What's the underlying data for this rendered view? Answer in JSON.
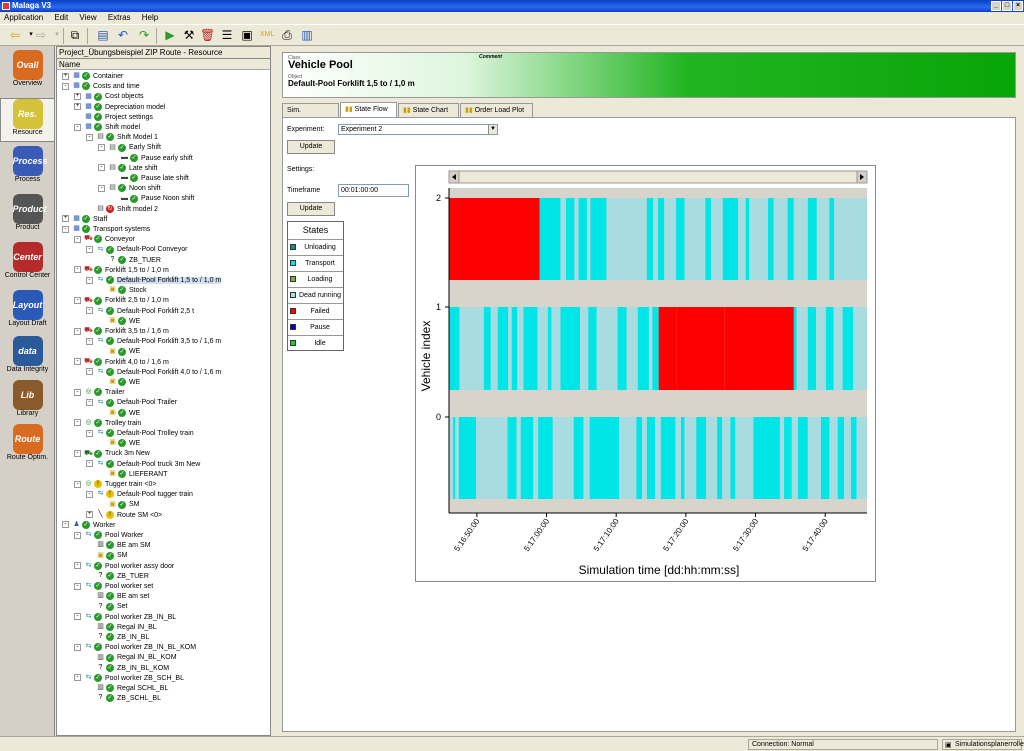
{
  "window": {
    "title": "Malaga V3"
  },
  "menu": [
    "Application",
    "Edit",
    "View",
    "Extras",
    "Help"
  ],
  "leftbar": [
    {
      "label": "Overview",
      "icon": "overview-icon",
      "color": "#d86b20",
      "text": "Ovall"
    },
    {
      "label": "Resource",
      "icon": "resource-icon",
      "color": "#d4c33a",
      "text": "Res.",
      "active": true
    },
    {
      "label": "Process",
      "icon": "process-icon",
      "color": "#3a5ab8",
      "text": "Process"
    },
    {
      "label": "Product",
      "icon": "product-icon",
      "color": "#555",
      "text": "Product"
    },
    {
      "label": "Control Center",
      "icon": "control-center-icon",
      "color": "#b52a2a",
      "text": "Center"
    },
    {
      "label": "Layout Draft",
      "icon": "layout-draft-icon",
      "color": "#2a5ab8",
      "text": "Layout"
    },
    {
      "label": "Data Integrity",
      "icon": "data-integrity-icon",
      "color": "#2a5a9a",
      "text": "data"
    },
    {
      "label": "Library",
      "icon": "library-icon",
      "color": "#8a5a2a",
      "text": "Lib"
    },
    {
      "label": "Route Optim.",
      "icon": "route-optim-icon",
      "color": "#d86b20",
      "text": "Route"
    }
  ],
  "tree": {
    "title": "Project_Übungsbeispiel ZIP Route - Resource",
    "column": "Name",
    "rows": [
      {
        "t": "Container",
        "l": 0,
        "ex": "+",
        "i": "tb",
        "c": "check"
      },
      {
        "t": "Costs and time",
        "l": 0,
        "ex": "-",
        "i": "tb",
        "c": "check"
      },
      {
        "t": "Cost objects",
        "l": 1,
        "ex": "+",
        "i": "tb",
        "c": "check"
      },
      {
        "t": "Depreciation model",
        "l": 1,
        "ex": "+",
        "i": "tb",
        "c": "check"
      },
      {
        "t": "Project settings",
        "l": 1,
        "ex": "",
        "i": "tb",
        "c": "check"
      },
      {
        "t": "Shift model",
        "l": 1,
        "ex": "-",
        "i": "tb",
        "c": "check"
      },
      {
        "t": "Shift Model 1",
        "l": 2,
        "ex": "-",
        "i": "cal",
        "c": "check"
      },
      {
        "t": "Early Shift",
        "l": 3,
        "ex": "-",
        "i": "cal",
        "c": "check"
      },
      {
        "t": "Pause early shift",
        "l": 4,
        "ex": "",
        "i": "bed",
        "c": "check"
      },
      {
        "t": "Late shift",
        "l": 3,
        "ex": "-",
        "i": "cal",
        "c": "check"
      },
      {
        "t": "Pause late shift",
        "l": 4,
        "ex": "",
        "i": "bed",
        "c": "check"
      },
      {
        "t": "Noon shift",
        "l": 3,
        "ex": "-",
        "i": "cal",
        "c": "check"
      },
      {
        "t": "Pause Noon shift",
        "l": 4,
        "ex": "",
        "i": "bed",
        "c": "check"
      },
      {
        "t": "Shift model 2",
        "l": 2,
        "ex": "",
        "i": "cal",
        "c": "red"
      },
      {
        "t": "Staff",
        "l": 0,
        "ex": "+",
        "i": "tb",
        "c": "check"
      },
      {
        "t": "Transport systems",
        "l": 0,
        "ex": "-",
        "i": "tb",
        "c": "check"
      },
      {
        "t": "Conveyor",
        "l": 1,
        "ex": "-",
        "i": "fork",
        "c": "check"
      },
      {
        "t": "Default-Pool Conveyor",
        "l": 2,
        "ex": "-",
        "i": "pool",
        "c": "check"
      },
      {
        "t": "ZB_TUER",
        "l": 3,
        "ex": "",
        "i": "q",
        "c": "check"
      },
      {
        "t": "Forklift 1,5 to / 1,0 m",
        "l": 1,
        "ex": "-",
        "i": "fork",
        "c": "check"
      },
      {
        "t": "Default-Pool Forklift 1,5 to / 1,0 m",
        "l": 2,
        "ex": "-",
        "i": "pool",
        "c": "check",
        "sel": true
      },
      {
        "t": "Stock",
        "l": 3,
        "ex": "",
        "i": "box",
        "c": "check"
      },
      {
        "t": "Forklift 2,5 to / 1,0 m",
        "l": 1,
        "ex": "-",
        "i": "fork",
        "c": "check"
      },
      {
        "t": "Default-Pool Forklift 2,5 t",
        "l": 2,
        "ex": "-",
        "i": "pool",
        "c": "check"
      },
      {
        "t": "WE",
        "l": 3,
        "ex": "",
        "i": "box",
        "c": "check"
      },
      {
        "t": "Forklift 3,5 to / 1,6 m",
        "l": 1,
        "ex": "-",
        "i": "fork",
        "c": "check"
      },
      {
        "t": "Default-Pool Forklift 3,5 to / 1,6 m",
        "l": 2,
        "ex": "-",
        "i": "pool",
        "c": "check"
      },
      {
        "t": "WE",
        "l": 3,
        "ex": "",
        "i": "box",
        "c": "check"
      },
      {
        "t": "Forklift 4,0 to / 1,6 m",
        "l": 1,
        "ex": "-",
        "i": "fork",
        "c": "check"
      },
      {
        "t": "Default-Pool Forklift 4,0 to / 1,6 m",
        "l": 2,
        "ex": "-",
        "i": "pool",
        "c": "check"
      },
      {
        "t": "WE",
        "l": 3,
        "ex": "",
        "i": "box",
        "c": "check"
      },
      {
        "t": "Trailer",
        "l": 1,
        "ex": "-",
        "i": "ring",
        "c": "check"
      },
      {
        "t": "Default-Pool Trailer",
        "l": 2,
        "ex": "-",
        "i": "pool",
        "c": "check"
      },
      {
        "t": "WE",
        "l": 3,
        "ex": "",
        "i": "box",
        "c": "check"
      },
      {
        "t": "Trolley train",
        "l": 1,
        "ex": "-",
        "i": "ring",
        "c": "check"
      },
      {
        "t": "Default-Pool Trolley train",
        "l": 2,
        "ex": "-",
        "i": "pool",
        "c": "check"
      },
      {
        "t": "WE",
        "l": 3,
        "ex": "",
        "i": "box",
        "c": "check"
      },
      {
        "t": "Truck 3m New",
        "l": 1,
        "ex": "-",
        "i": "truck",
        "c": "check"
      },
      {
        "t": "Default-Pool truck 3m New",
        "l": 2,
        "ex": "-",
        "i": "pool",
        "c": "check"
      },
      {
        "t": "LIEFERANT",
        "l": 3,
        "ex": "",
        "i": "box",
        "c": "check"
      },
      {
        "t": "Tugger train <0>",
        "l": 1,
        "ex": "-",
        "i": "ring",
        "c": "warn"
      },
      {
        "t": "Default-Pool tugger train",
        "l": 2,
        "ex": "-",
        "i": "pool",
        "c": "warn"
      },
      {
        "t": "SM",
        "l": 3,
        "ex": "",
        "i": "box",
        "c": "check"
      },
      {
        "t": "Route SM <0>",
        "l": 2,
        "ex": "+",
        "i": "route",
        "c": "warn"
      },
      {
        "t": "Worker",
        "l": 0,
        "ex": "-",
        "i": "person",
        "c": "check"
      },
      {
        "t": "Pool Worker",
        "l": 1,
        "ex": "-",
        "i": "pool",
        "c": "check"
      },
      {
        "t": "BE am SM",
        "l": 2,
        "ex": "",
        "i": "rack",
        "c": "check"
      },
      {
        "t": "SM",
        "l": 2,
        "ex": "",
        "i": "box",
        "c": "check"
      },
      {
        "t": "Pool worker assy door",
        "l": 1,
        "ex": "-",
        "i": "pool",
        "c": "check"
      },
      {
        "t": "ZB_TUER",
        "l": 2,
        "ex": "",
        "i": "q",
        "c": "check"
      },
      {
        "t": "Pool worker set",
        "l": 1,
        "ex": "-",
        "i": "pool",
        "c": "check"
      },
      {
        "t": "BE am set",
        "l": 2,
        "ex": "",
        "i": "rack",
        "c": "check"
      },
      {
        "t": "Set",
        "l": 2,
        "ex": "",
        "i": "q",
        "c": "check"
      },
      {
        "t": "Pool worker ZB_IN_BL",
        "l": 1,
        "ex": "-",
        "i": "pool",
        "c": "check"
      },
      {
        "t": "Regal IN_BL",
        "l": 2,
        "ex": "",
        "i": "rack",
        "c": "check"
      },
      {
        "t": "ZB_IN_BL",
        "l": 2,
        "ex": "",
        "i": "q",
        "c": "check"
      },
      {
        "t": "Pool worker ZB_IN_BL_KOM",
        "l": 1,
        "ex": "-",
        "i": "pool",
        "c": "check"
      },
      {
        "t": "Regal IN_BL_KOM",
        "l": 2,
        "ex": "",
        "i": "rack",
        "c": "check"
      },
      {
        "t": "ZB_IN_BL_KOM",
        "l": 2,
        "ex": "",
        "i": "q",
        "c": "check"
      },
      {
        "t": "Pool worker ZB_SCH_BL",
        "l": 1,
        "ex": "-",
        "i": "pool",
        "c": "check"
      },
      {
        "t": "Regal SCHL_BL",
        "l": 2,
        "ex": "",
        "i": "rack",
        "c": "check"
      },
      {
        "t": "ZB_SCHL_BL",
        "l": 2,
        "ex": "",
        "i": "q",
        "c": "check"
      }
    ]
  },
  "header": {
    "class_label": "Class",
    "comment_label": "Comment",
    "title": "Vehicle Pool",
    "object_label": "Object",
    "object": "Default-Pool Forklift 1,5 to / 1,0 m"
  },
  "tabs": [
    "Sim. properties",
    "State Flow",
    "State Chart",
    "Order Load Plot"
  ],
  "form": {
    "experiment_label": "Experiment:",
    "experiment_value": "Experiment 2",
    "update1": "Update",
    "settings_label": "Settings:",
    "timeframe_label": "Timeframe",
    "timeframe_value": "00:01:00:00",
    "update2": "Update"
  },
  "states": {
    "title": "States",
    "items": [
      {
        "name": "Unloading",
        "color": "#1a8a8a"
      },
      {
        "name": "Transport",
        "color": "#00e5e5"
      },
      {
        "name": "Loading",
        "color": "#7fb03a"
      },
      {
        "name": "Dead running",
        "color": "#a8dce0"
      },
      {
        "name": "Failed",
        "color": "#ff0000"
      },
      {
        "name": "Pause",
        "color": "#0000c0"
      },
      {
        "name": "Idle",
        "color": "#22cc22"
      }
    ]
  },
  "chart_data": {
    "type": "gantt",
    "ylabel": "Vehicle index",
    "xlabel": "Simulation time [dd:hh:mm:ss]",
    "yticks": [
      "0",
      "1",
      "2"
    ],
    "xticks": [
      "5:16:50:00",
      "5:17:00:00",
      "5:17:10:00",
      "5:17:20:00",
      "5:17:30:00",
      "5:17:40:00"
    ],
    "x_range_min": [
      1006,
      1066
    ],
    "tick_min": [
      1010,
      1020,
      1030,
      1040,
      1050,
      1060
    ],
    "colors": {
      "T": "#00e5e5",
      "D": "#a8dce0",
      "F": "#ff0000",
      "U": "#1a8a8a"
    },
    "vehicles": [
      {
        "index": 2,
        "segments": [
          [
            1006,
            1019,
            "F"
          ],
          [
            1019,
            1021,
            "T"
          ],
          [
            1021,
            1022,
            "T"
          ],
          [
            1022,
            1022.8,
            "D"
          ],
          [
            1022.8,
            1024,
            "T"
          ],
          [
            1024,
            1024.6,
            "D"
          ],
          [
            1024.6,
            1025.8,
            "T"
          ],
          [
            1025.8,
            1026.3,
            "D"
          ],
          [
            1026.3,
            1028.6,
            "T"
          ],
          [
            1028.6,
            1034.4,
            "D"
          ],
          [
            1034.4,
            1035.3,
            "T"
          ],
          [
            1035.3,
            1036,
            "D"
          ],
          [
            1036,
            1036.9,
            "T"
          ],
          [
            1036.9,
            1038.6,
            "D"
          ],
          [
            1038.6,
            1039.8,
            "T"
          ],
          [
            1039.8,
            1042.8,
            "D"
          ],
          [
            1042.8,
            1043.6,
            "T"
          ],
          [
            1043.6,
            1045.3,
            "D"
          ],
          [
            1045.3,
            1047.5,
            "T"
          ],
          [
            1047.5,
            1048.6,
            "D"
          ],
          [
            1048.6,
            1049.1,
            "T"
          ],
          [
            1049.1,
            1051.8,
            "D"
          ],
          [
            1051.8,
            1052.6,
            "T"
          ],
          [
            1052.6,
            1054.6,
            "D"
          ],
          [
            1054.6,
            1055.5,
            "T"
          ],
          [
            1055.5,
            1057.5,
            "D"
          ],
          [
            1057.5,
            1058.8,
            "T"
          ],
          [
            1058.8,
            1060.6,
            "D"
          ],
          [
            1060.6,
            1061.3,
            "T"
          ],
          [
            1061.3,
            1066,
            "D"
          ]
        ]
      },
      {
        "index": 1,
        "segments": [
          [
            1006,
            1007.5,
            "T"
          ],
          [
            1007.5,
            1011,
            "D"
          ],
          [
            1011,
            1012,
            "T"
          ],
          [
            1012,
            1013,
            "D"
          ],
          [
            1013,
            1014.5,
            "T"
          ],
          [
            1014.5,
            1015,
            "D"
          ],
          [
            1015,
            1015.8,
            "T"
          ],
          [
            1015.8,
            1016.7,
            "D"
          ],
          [
            1016.7,
            1018.7,
            "T"
          ],
          [
            1018.7,
            1020.2,
            "D"
          ],
          [
            1020.2,
            1020.7,
            "T"
          ],
          [
            1020.7,
            1022,
            "D"
          ],
          [
            1022,
            1024.8,
            "T"
          ],
          [
            1024.8,
            1026,
            "D"
          ],
          [
            1026,
            1027.2,
            "T"
          ],
          [
            1027.2,
            1030.2,
            "D"
          ],
          [
            1030.2,
            1031.5,
            "T"
          ],
          [
            1031.5,
            1033.1,
            "D"
          ],
          [
            1033.1,
            1034.7,
            "T"
          ],
          [
            1034.7,
            1035.2,
            "D"
          ],
          [
            1035.2,
            1036.1,
            "T"
          ],
          [
            1036.1,
            1038.6,
            "F"
          ],
          [
            1038.6,
            1045.5,
            "F"
          ],
          [
            1045.5,
            1055.5,
            "F"
          ],
          [
            1055.5,
            1055.9,
            "T"
          ],
          [
            1055.9,
            1057.5,
            "D"
          ],
          [
            1057.5,
            1058.7,
            "T"
          ],
          [
            1058.7,
            1060.1,
            "D"
          ],
          [
            1060.1,
            1061.2,
            "T"
          ],
          [
            1061.2,
            1062.5,
            "D"
          ],
          [
            1062.5,
            1064,
            "T"
          ],
          [
            1064,
            1066,
            "D"
          ]
        ]
      },
      {
        "index": 0,
        "segments": [
          [
            1006,
            1006.6,
            "D"
          ],
          [
            1006.6,
            1006.9,
            "T"
          ],
          [
            1006.9,
            1007.4,
            "D"
          ],
          [
            1007.4,
            1009.9,
            "T"
          ],
          [
            1009.9,
            1014.4,
            "D"
          ],
          [
            1014.4,
            1015.7,
            "T"
          ],
          [
            1015.7,
            1016.3,
            "D"
          ],
          [
            1016.3,
            1018.1,
            "T"
          ],
          [
            1018.1,
            1018.8,
            "D"
          ],
          [
            1018.8,
            1020.9,
            "T"
          ],
          [
            1020.9,
            1023.9,
            "D"
          ],
          [
            1023.9,
            1025.3,
            "T"
          ],
          [
            1025.3,
            1026.2,
            "D"
          ],
          [
            1026.2,
            1030.4,
            "T"
          ],
          [
            1030.4,
            1032.9,
            "D"
          ],
          [
            1032.9,
            1033.7,
            "T"
          ],
          [
            1033.7,
            1034.4,
            "D"
          ],
          [
            1034.4,
            1035.6,
            "T"
          ],
          [
            1035.6,
            1036.4,
            "D"
          ],
          [
            1036.4,
            1038.5,
            "T"
          ],
          [
            1038.5,
            1039.3,
            "D"
          ],
          [
            1039.3,
            1039.8,
            "T"
          ],
          [
            1039.8,
            1041.5,
            "D"
          ],
          [
            1041.5,
            1042.9,
            "T"
          ],
          [
            1042.9,
            1044.5,
            "D"
          ],
          [
            1044.5,
            1045.2,
            "T"
          ],
          [
            1045.2,
            1046.4,
            "D"
          ],
          [
            1046.4,
            1047.1,
            "T"
          ],
          [
            1047.1,
            1049.7,
            "D"
          ],
          [
            1049.7,
            1053.5,
            "T"
          ],
          [
            1053.5,
            1054.1,
            "D"
          ],
          [
            1054.1,
            1055.2,
            "T"
          ],
          [
            1055.2,
            1056.1,
            "D"
          ],
          [
            1056.1,
            1057.5,
            "T"
          ],
          [
            1057.5,
            1059.4,
            "D"
          ],
          [
            1059.4,
            1060.6,
            "T"
          ],
          [
            1060.6,
            1061.8,
            "D"
          ],
          [
            1061.8,
            1062.7,
            "T"
          ],
          [
            1062.7,
            1063.7,
            "D"
          ],
          [
            1063.7,
            1064.5,
            "T"
          ],
          [
            1064.5,
            1066,
            "D"
          ]
        ]
      }
    ]
  },
  "statusbar": {
    "connection": "Connection: Normal",
    "user": "Simulationsplanerrolle"
  }
}
